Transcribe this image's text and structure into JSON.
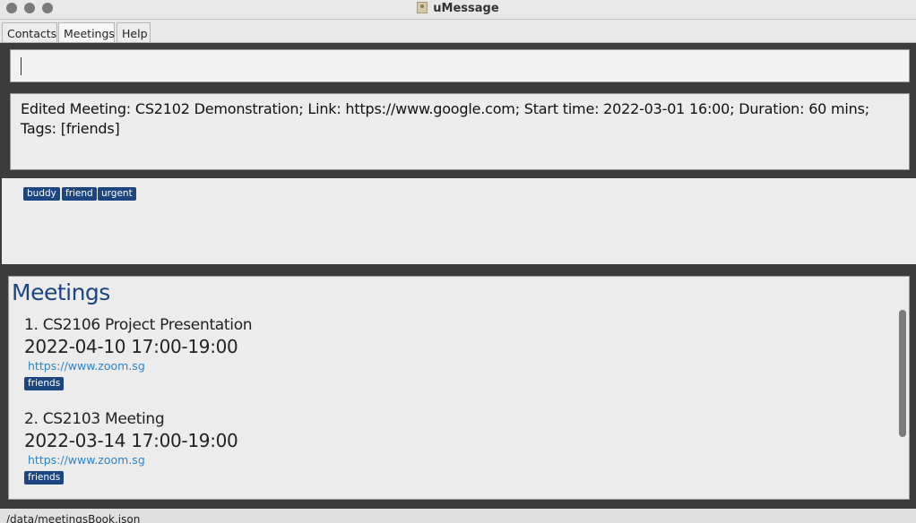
{
  "window": {
    "title": "uMessage"
  },
  "menu": {
    "items": [
      {
        "label": "Contacts"
      },
      {
        "label": "Meetings"
      },
      {
        "label": "Help"
      }
    ]
  },
  "command": {
    "value": ""
  },
  "result": {
    "text": "Edited Meeting: CS2102 Demonstration; Link: https://www.google.com; Start time: 2022-03-01 16:00; Duration: 60 mins; Tags: [friends]"
  },
  "tags": [
    "buddy",
    "friend",
    "urgent"
  ],
  "meetings": {
    "heading": "Meetings",
    "items": [
      {
        "title": "1.  CS2106 Project Presentation",
        "time": "2022-04-10 17:00-19:00",
        "link": "https://www.zoom.sg",
        "tag": "friends"
      },
      {
        "title": "2.  CS2103 Meeting",
        "time": "2022-03-14 17:00-19:00",
        "link": "https://www.zoom.sg",
        "tag": "friends"
      }
    ]
  },
  "status": {
    "path": "/data/meetingsBook.json"
  },
  "colors": {
    "accent": "#1d4580",
    "link": "#2a86c9",
    "background": "#3c3c3c"
  }
}
